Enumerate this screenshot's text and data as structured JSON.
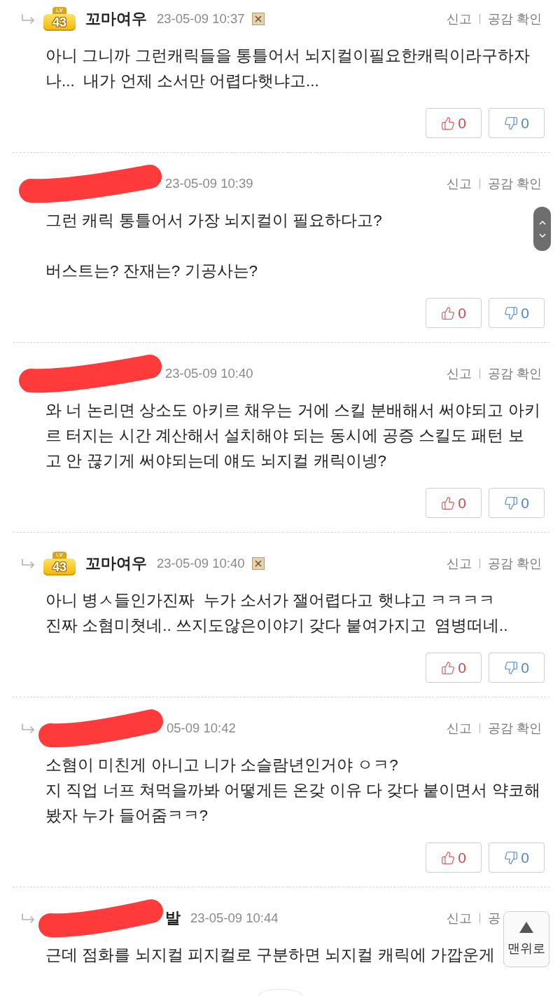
{
  "comments": [
    {
      "reply_arrow": true,
      "redacted": false,
      "level_badge": {
        "label": "LV",
        "level": "43"
      },
      "author": "꼬마여우",
      "timestamp": "23-05-09 10:37",
      "x_icon": true,
      "actions": [
        "신고",
        "공감 확인"
      ],
      "body": "아니 그니까 그런캐릭들을 통틀어서 뇌지컬이필요한캐릭이라구하자\n나...  내가 언제 소서만 어렵다햇냐고...",
      "likes": "0",
      "dislikes": "0"
    },
    {
      "reply_arrow": false,
      "redacted": true,
      "timestamp": "23-05-09 10:39",
      "x_icon": false,
      "actions": [
        "신고",
        "공감 확인"
      ],
      "body": "그런 캐릭 통틀어서 가장 뇌지컬이 필요하다고?\n\n버스트는? 잔재는? 기공사는?",
      "likes": "0",
      "dislikes": "0"
    },
    {
      "reply_arrow": false,
      "redacted": true,
      "timestamp": "23-05-09 10:40",
      "x_icon": false,
      "actions": [
        "신고",
        "공감 확인"
      ],
      "body": "와 너 논리면 상소도 아키르 채우는 거에 스킬 분배해서 써야되고 아키\n르 터지는 시간 계산해서 설치해야 되는 동시에 공증 스킬도 패턴 보\n고 안 끊기게 써야되는데 얘도 뇌지컬 캐릭이넹?",
      "likes": "0",
      "dislikes": "0"
    },
    {
      "reply_arrow": true,
      "redacted": false,
      "level_badge": {
        "label": "LV",
        "level": "43"
      },
      "author": "꼬마여우",
      "timestamp": "23-05-09 10:40",
      "x_icon": true,
      "actions": [
        "신고",
        "공감 확인"
      ],
      "body": "아니 병ㅅ들인가진짜  누가 소서가 잴어렵다고 햇냐고 ㅋㅋㅋㅋ\n진짜 소혐미쳣네.. 쓰지도않은이야기 갖다 붙여가지고  염병떠네..",
      "likes": "0",
      "dislikes": "0"
    },
    {
      "reply_arrow": true,
      "redacted": true,
      "timestamp": "05-09 10:42",
      "x_icon": false,
      "actions": [
        "신고",
        "공감 확인"
      ],
      "body": "소혐이 미친게 아니고 니가 소슬람년인거야 ㅇㅋ?\n지 직업 너프 쳐먹을까봐 어떻게든 온갖 이유 다 갖다 붙이면서 약코해\n봤자 누가 들어줌ㅋㅋ?",
      "likes": "0",
      "dislikes": "0"
    },
    {
      "reply_arrow": true,
      "redacted": true,
      "author": "발",
      "timestamp": "23-05-09 10:44",
      "x_icon": false,
      "actions": [
        "신고",
        "공"
      ],
      "body": "근데 점화를 뇌지컬 피지컬로 구분하면 뇌지컬 캐릭에 가깝운게"
    }
  ],
  "scroll_top_button": {
    "label": "맨위로"
  }
}
